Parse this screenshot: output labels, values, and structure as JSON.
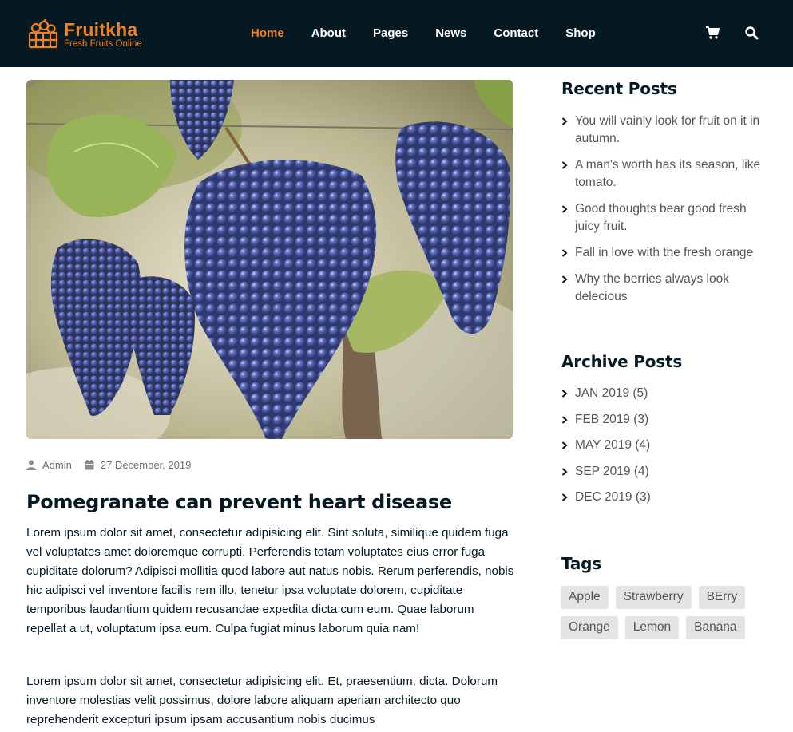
{
  "brand": {
    "name": "Fruitkha",
    "tagline": "Fresh Fruits Online",
    "accent": "#F28123",
    "dark": "#051922"
  },
  "nav": {
    "items": [
      {
        "label": "Home",
        "active": true
      },
      {
        "label": "About",
        "active": false
      },
      {
        "label": "Pages",
        "active": false
      },
      {
        "label": "News",
        "active": false
      },
      {
        "label": "Contact",
        "active": false
      },
      {
        "label": "Shop",
        "active": false
      }
    ],
    "icons": [
      "shopping-cart-icon",
      "search-icon"
    ]
  },
  "post": {
    "image": "grapes-photo",
    "author": "Admin",
    "date": "27 December, 2019",
    "title": "Pomegranate can prevent heart disease",
    "paragraphs": [
      "Lorem ipsum dolor sit amet, consectetur adipisicing elit. Sint soluta, similique quidem fuga vel voluptates amet doloremque corrupti. Perferendis totam voluptates eius error fuga cupiditate dolorum? Adipisci mollitia quod labore aut natus nobis. Rerum perferendis, nobis hic adipisci vel inventore facilis rem illo, tenetur ipsa voluptate dolorem, cupiditate temporibus laudantium quidem recusandae expedita dicta cum eum. Quae laborum repellat a ut, voluptatum ipsa eum. Culpa fugiat minus laborum quia nam!",
      "Lorem ipsum dolor sit amet, consectetur adipisicing elit. Et, praesentium, dicta. Dolorum inventore molestias velit possimus, dolore labore aliquam aperiam architecto quo reprehenderit excepturi ipsum ipsam accusantium nobis ducimus"
    ]
  },
  "sidebar": {
    "recent": {
      "heading": "Recent Posts",
      "items": [
        "You will vainly look for fruit on it in autumn.",
        "A man's worth has its season, like tomato.",
        "Good thoughts bear good fresh juicy fruit.",
        "Fall in love with the fresh orange",
        "Why the berries always look delecious"
      ]
    },
    "archive": {
      "heading": "Archive Posts",
      "items": [
        "JAN 2019 (5)",
        "FEB 2019 (3)",
        "MAY 2019 (4)",
        "SEP 2019 (4)",
        "DEC 2019 (3)"
      ]
    },
    "tags": {
      "heading": "Tags",
      "items": [
        "Apple",
        "Strawberry",
        "BErry",
        "Orange",
        "Lemon",
        "Banana"
      ]
    }
  }
}
